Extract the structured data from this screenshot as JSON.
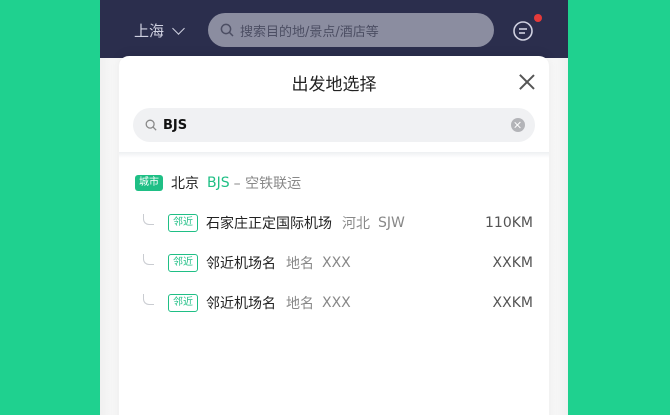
{
  "header": {
    "city": "上海",
    "search_placeholder": "搜索目的地/景点/酒店等",
    "message_icon": "message-icon"
  },
  "sheet": {
    "title": "出发地选择",
    "search_value": "BJS",
    "result": {
      "tag": "城市",
      "name": "北京",
      "code": "BJS",
      "extra": "– 空铁联运"
    },
    "nearby": [
      {
        "tag": "邻近",
        "name": "石家庄正定国际机场",
        "region": "河北",
        "code": "SJW",
        "distance": "110KM"
      },
      {
        "tag": "邻近",
        "name": "邻近机场名",
        "region": "地名",
        "code": "XXX",
        "distance": "XXKM"
      },
      {
        "tag": "邻近",
        "name": "邻近机场名",
        "region": "地名",
        "code": "XXX",
        "distance": "XXKM"
      }
    ]
  },
  "colors": {
    "background": "#1fd18f",
    "header": "#2b2e4d",
    "accent": "#1fbf85"
  }
}
